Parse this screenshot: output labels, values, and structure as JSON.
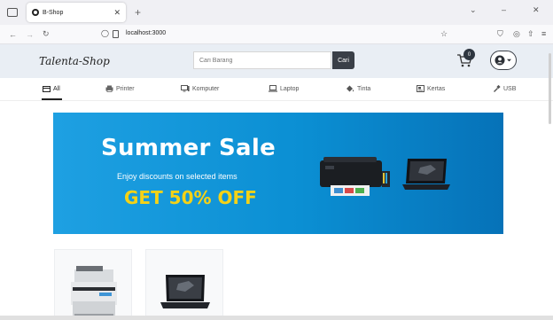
{
  "browser": {
    "tab_title": "B-Shop",
    "url": "localhost:3000"
  },
  "header": {
    "logo": "Talenta-Shop",
    "search_placeholder": "Cari Barang",
    "search_button": "Cari",
    "cart_count": "0"
  },
  "categories": [
    {
      "label": "All",
      "icon": "box-icon"
    },
    {
      "label": "Printer",
      "icon": "printer-icon"
    },
    {
      "label": "Komputer",
      "icon": "desktop-icon"
    },
    {
      "label": "Laptop",
      "icon": "laptop-icon"
    },
    {
      "label": "Tinta",
      "icon": "ink-icon"
    },
    {
      "label": "Kertas",
      "icon": "paper-icon"
    },
    {
      "label": "USB",
      "icon": "usb-icon"
    }
  ],
  "banner": {
    "title": "Summer Sale",
    "subtitle": "Enjoy discounts on selected items",
    "offer": "GET 50% OFF"
  },
  "colors": {
    "banner_blue": "#0b8fd3",
    "offer_yellow": "#f5d216",
    "header_bg": "#e9eef4",
    "dark": "#3a3f47"
  }
}
